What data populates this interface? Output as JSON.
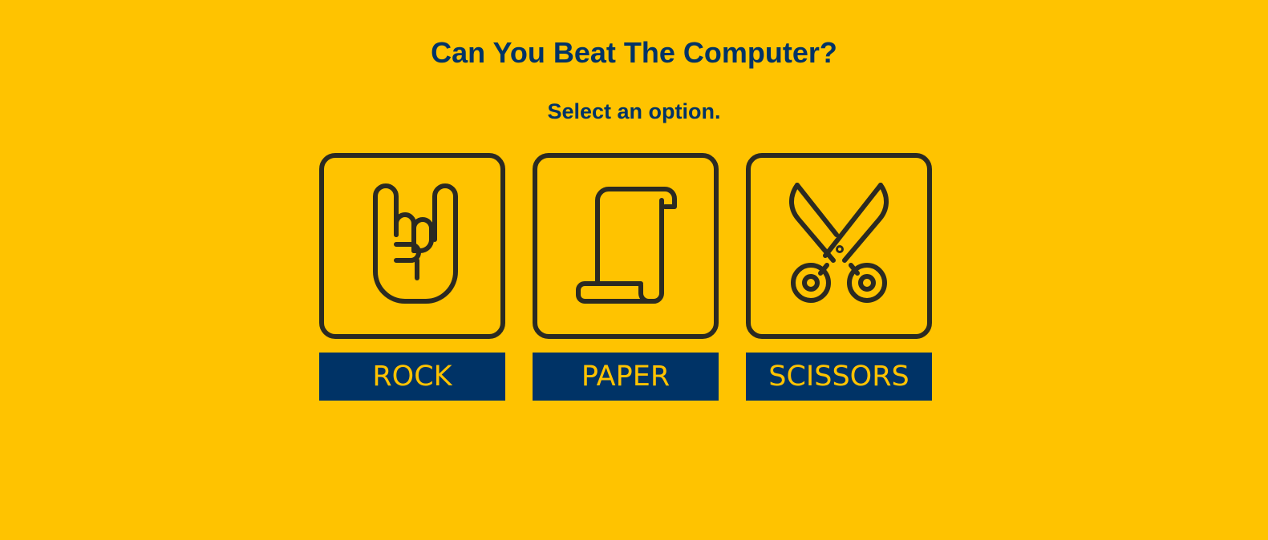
{
  "header": {
    "title": "Can You Beat The Computer?",
    "subtitle": "Select an option."
  },
  "options": [
    {
      "label": "ROCK",
      "icon": "rock-hand-icon"
    },
    {
      "label": "PAPER",
      "icon": "paper-scroll-icon"
    },
    {
      "label": "SCISSORS",
      "icon": "scissors-icon"
    }
  ],
  "colors": {
    "background": "#FFC300",
    "text": "#003366",
    "button_bg": "#003366",
    "button_text": "#FFC300",
    "icon_stroke": "#2b2a22"
  }
}
